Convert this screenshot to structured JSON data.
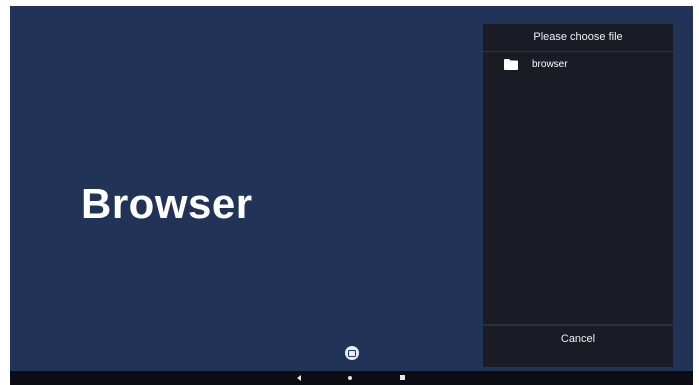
{
  "app": {
    "title": "Browser"
  },
  "dialog": {
    "title": "Please choose file",
    "items": [
      {
        "name": "browser",
        "icon": "folder-icon"
      }
    ],
    "cancel_label": "Cancel"
  },
  "colors": {
    "background": "#213356",
    "dialog_background": "#191c24",
    "nav_bar": "#0b0d12"
  },
  "nav": {
    "back_icon": "back-icon",
    "home_icon": "home-icon",
    "recents_icon": "recents-icon"
  }
}
